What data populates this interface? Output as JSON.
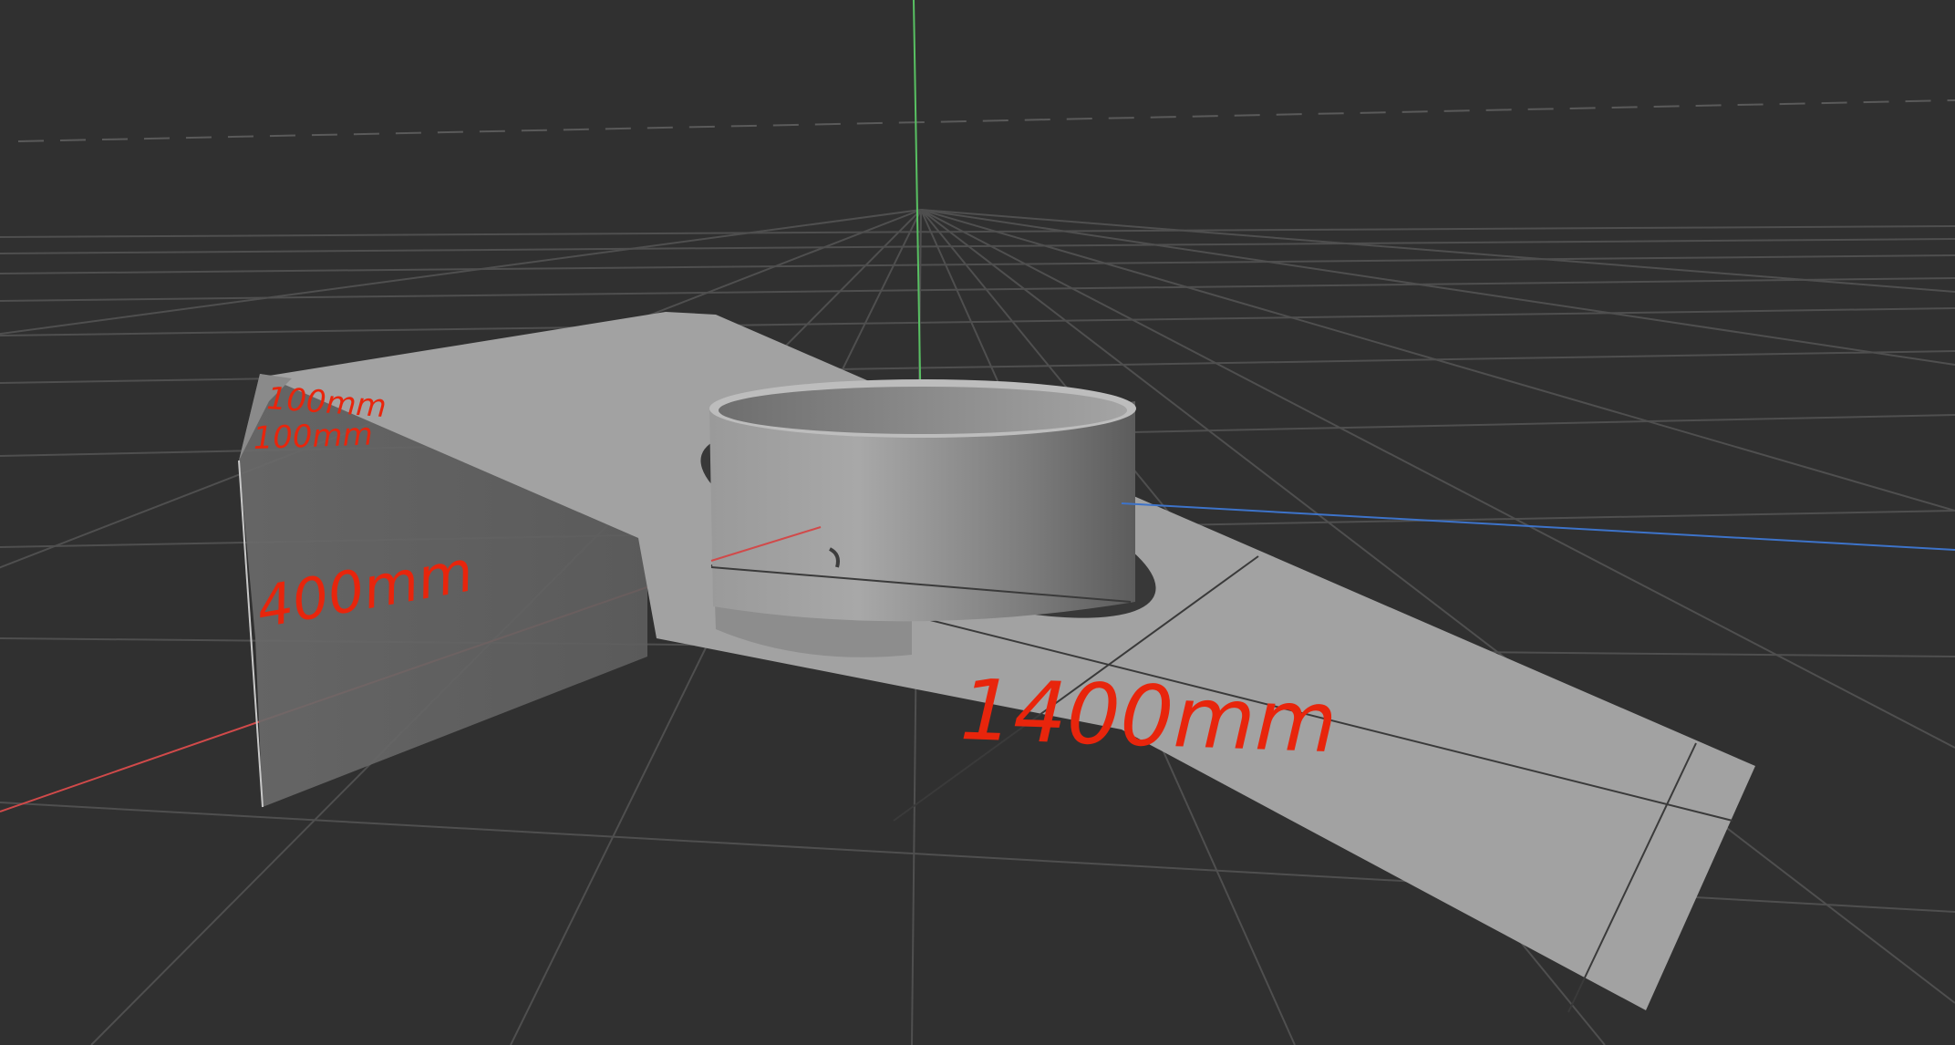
{
  "viewport": {
    "background_color": "#303030",
    "grid_color": "#5a5a5a",
    "axis_x_color": "#d14a4a",
    "axis_y_color": "#58c062",
    "axis_z_color": "#3d73c9",
    "model_face_light": "#a3a3a3",
    "model_face_side": "#6e6e6e",
    "annotation_color": "#e8250c"
  },
  "annotations": {
    "small_dim_1": "100mm",
    "small_dim_2": "100mm",
    "height_dim": "400mm",
    "length_dim": "1400mm"
  }
}
